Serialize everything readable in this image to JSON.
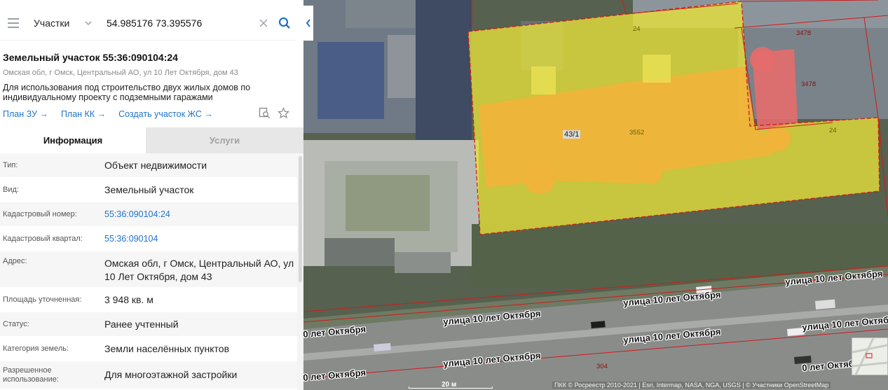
{
  "search": {
    "layer": "Участки",
    "query": "54.985176 73.395576"
  },
  "plot": {
    "title": "Земельный участок 55:36:090104:24",
    "address": "Омская обл, г Омск, Центральный АО, ул 10 Лет Октября, дом 43",
    "description": "Для использования под строительство двух жилых домов по индивидуальному проекту с подземными гаражами",
    "links": [
      "План ЗУ →",
      "План КК →",
      "Создать участок ЖС →"
    ]
  },
  "tabs": {
    "info": "Информация",
    "services": "Услуги"
  },
  "properties": [
    {
      "key": "Тип:",
      "value": "Объект недвижимости"
    },
    {
      "key": "Вид:",
      "value": "Земельный участок"
    },
    {
      "key": "Кадастровый номер:",
      "value": "55:36:090104:24"
    },
    {
      "key": "Кадастровый квартал:",
      "value": "55:36:090104"
    },
    {
      "key": "Адрес:",
      "value": "Омская обл, г Омск, Центральный АО, ул 10 Лет Октября, дом 43"
    },
    {
      "key": "Площадь уточненная:",
      "value": "3 948 кв. м"
    },
    {
      "key": "Статус:",
      "value": "Ранее учтенный"
    },
    {
      "key": "Категория земель:",
      "value": "Земли населённых пунктов"
    },
    {
      "key": "Разрешенное использование:",
      "value": "Для многоэтажной застройки"
    }
  ],
  "map": {
    "plot_numbers": [
      "24",
      "24",
      "3552",
      "3478",
      "3478",
      "304"
    ],
    "building": "43/1",
    "streets": [
      "улица 10 лет Октября",
      "улица 10 лет Октября",
      "улица 10 лет Октября",
      "улица 10 лет Октября",
      "улица 10 лет Октября",
      "улица 10 лет Октября",
      "0 лет Октября",
      "0 лет Октября",
      "0 лет Октября"
    ],
    "scale": "20 м",
    "attribution": "ПКК © Росреестр 2010-2021 | Esri, Intermap, NASA, NGA, USGS | © Участники OpenStreetMap"
  },
  "colors": {
    "link": "#1f73c9",
    "search_accent": "#1f73c9",
    "parcel_yellow": "#e8e23a",
    "parcel_orange": "#f0b43a",
    "parcel_red": "#e56b6b",
    "boundary": "#d11a1a"
  },
  "icons": [
    "menu-icon",
    "chevron-down-icon",
    "close-icon",
    "search-icon",
    "collapse-left-icon",
    "search-document-icon",
    "star-icon"
  ]
}
